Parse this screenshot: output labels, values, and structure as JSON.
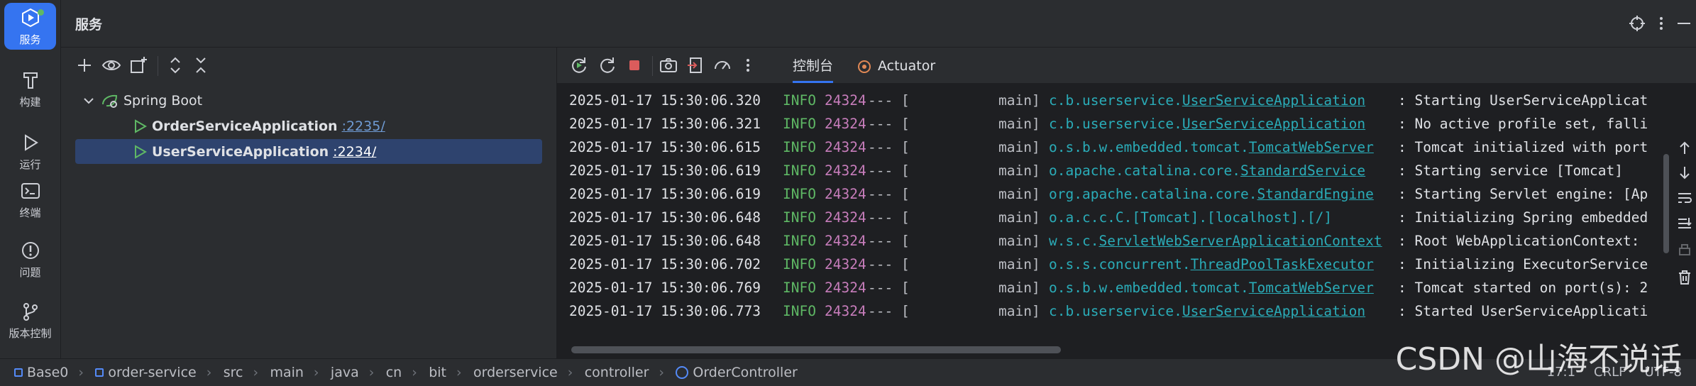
{
  "sidebar": {
    "items": [
      {
        "label": "服务",
        "icon": "services-icon",
        "active": true
      },
      {
        "label": "构建",
        "icon": "hammer-icon"
      },
      {
        "label": "运行",
        "icon": "run-icon"
      },
      {
        "label": "终端",
        "icon": "terminal-icon"
      },
      {
        "label": "问题",
        "icon": "problems-icon"
      },
      {
        "label": "版本控制",
        "icon": "git-branch-icon"
      }
    ]
  },
  "header": {
    "title": "服务"
  },
  "tree": {
    "group": "Spring Boot",
    "apps": [
      {
        "name": "OrderServiceApplication",
        "port": ":2235/"
      },
      {
        "name": "UserServiceApplication",
        "port": ":2234/",
        "selected": true
      }
    ]
  },
  "console": {
    "tabs": [
      {
        "label": "控制台",
        "active": true
      },
      {
        "label": "Actuator"
      }
    ],
    "log": [
      {
        "ts": "2025-01-17 15:30:06.320",
        "level": "INFO",
        "pid": "24324",
        "sep": "--- [",
        "thread": "main]",
        "logger_pre": "c.b.userservice.",
        "logger_link": "UserServiceApplication",
        "msg": ": Starting UserServiceApplicat"
      },
      {
        "ts": "2025-01-17 15:30:06.321",
        "level": "INFO",
        "pid": "24324",
        "sep": "--- [",
        "thread": "main]",
        "logger_pre": "c.b.userservice.",
        "logger_link": "UserServiceApplication",
        "msg": ": No active profile set, falli"
      },
      {
        "ts": "2025-01-17 15:30:06.615",
        "level": "INFO",
        "pid": "24324",
        "sep": "--- [",
        "thread": "main]",
        "logger_pre": "o.s.b.w.embedded.tomcat.",
        "logger_link": "TomcatWebServer",
        "msg": ": Tomcat initialized with port"
      },
      {
        "ts": "2025-01-17 15:30:06.619",
        "level": "INFO",
        "pid": "24324",
        "sep": "--- [",
        "thread": "main]",
        "logger_pre": "o.apache.catalina.core.",
        "logger_link": "StandardService",
        "msg": ": Starting service [Tomcat]"
      },
      {
        "ts": "2025-01-17 15:30:06.619",
        "level": "INFO",
        "pid": "24324",
        "sep": "--- [",
        "thread": "main]",
        "logger_pre": "org.apache.catalina.core.",
        "logger_link": "StandardEngine",
        "msg": ": Starting Servlet engine: [Ap"
      },
      {
        "ts": "2025-01-17 15:30:06.648",
        "level": "INFO",
        "pid": "24324",
        "sep": "--- [",
        "thread": "main]",
        "logger_pre": "o.a.c.c.C.[Tomcat].[localhost].[/]",
        "logger_link": "",
        "msg": ": Initializing Spring embedded"
      },
      {
        "ts": "2025-01-17 15:30:06.648",
        "level": "INFO",
        "pid": "24324",
        "sep": "--- [",
        "thread": "main]",
        "logger_pre": "w.s.c.",
        "logger_link": "ServletWebServerApplicationContext",
        "msg": ": Root WebApplicationContext:"
      },
      {
        "ts": "2025-01-17 15:30:06.702",
        "level": "INFO",
        "pid": "24324",
        "sep": "--- [",
        "thread": "main]",
        "logger_pre": "o.s.s.concurrent.",
        "logger_link": "ThreadPoolTaskExecutor",
        "msg": ": Initializing ExecutorService"
      },
      {
        "ts": "2025-01-17 15:30:06.769",
        "level": "INFO",
        "pid": "24324",
        "sep": "--- [",
        "thread": "main]",
        "logger_pre": "o.s.b.w.embedded.tomcat.",
        "logger_link": "TomcatWebServer",
        "msg": ": Tomcat started on port(s): 2"
      },
      {
        "ts": "2025-01-17 15:30:06.773",
        "level": "INFO",
        "pid": "24324",
        "sep": "--- [",
        "thread": "main]",
        "logger_pre": "c.b.userservice.",
        "logger_link": "UserServiceApplication",
        "msg": ": Started UserServiceApplicati"
      }
    ]
  },
  "status": {
    "breadcrumbs": [
      "Base0",
      "order-service",
      "src",
      "main",
      "java",
      "cn",
      "bit",
      "orderservice",
      "controller",
      "OrderController"
    ],
    "position": "17:1",
    "line_sep": "CRLF",
    "encoding": "UTF-8"
  },
  "watermark": "CSDN @山海不说话",
  "colors": {
    "accent": "#3574f0",
    "info": "#5fb865",
    "pid": "#c77dbb",
    "logger": "#2aacb8",
    "run_green": "#5fb865",
    "stop_red": "#db5c5c"
  }
}
